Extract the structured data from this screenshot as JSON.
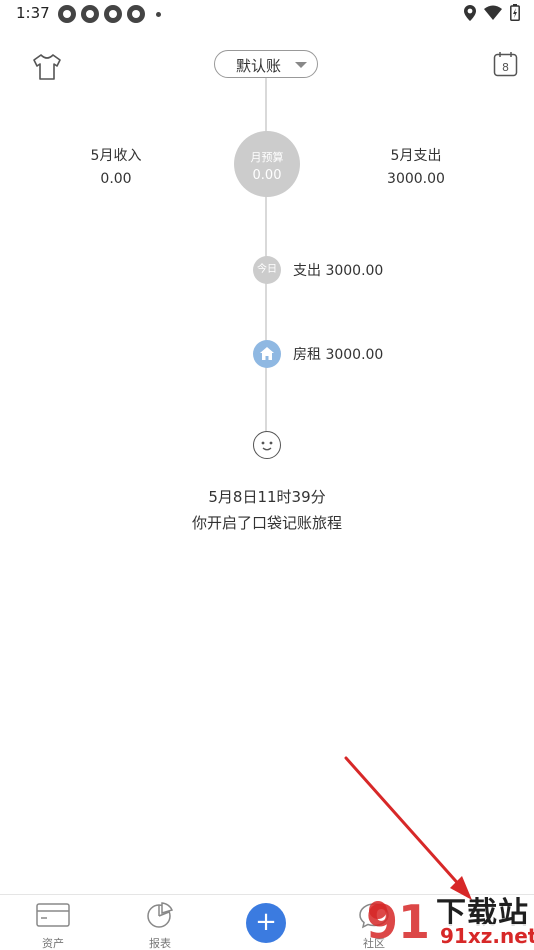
{
  "status_bar": {
    "time": "1:37"
  },
  "header": {
    "book_selector": "默认账"
  },
  "calendar": {
    "day": "8"
  },
  "summary": {
    "income_label": "5月收入",
    "income_value": "0.00",
    "budget_label": "月预算",
    "budget_value": "0.00",
    "expense_label": "5月支出",
    "expense_value": "3000.00"
  },
  "timeline": {
    "today_badge": "今日",
    "today_summary": "支出 3000.00",
    "entries": [
      {
        "icon": "home-icon",
        "text": "房租 3000.00"
      }
    ],
    "start_date": "5月8日11时39分",
    "start_message": "你开启了口袋记账旅程"
  },
  "bottom_nav": {
    "items": [
      {
        "label": "资产",
        "icon": "card-icon"
      },
      {
        "label": "报表",
        "icon": "pie-chart-icon"
      },
      {
        "label": "+",
        "icon": "add-icon"
      },
      {
        "label": "社区",
        "icon": "chat-bubble-icon"
      }
    ]
  },
  "watermark": {
    "logo_text": "91",
    "line1": "下载站",
    "line2": "91xz.net"
  },
  "colors": {
    "accent": "#3b7be0",
    "budget_circle": "#cccccc",
    "home_icon_bg": "#8fb8e2",
    "arrow": "#d72828"
  }
}
